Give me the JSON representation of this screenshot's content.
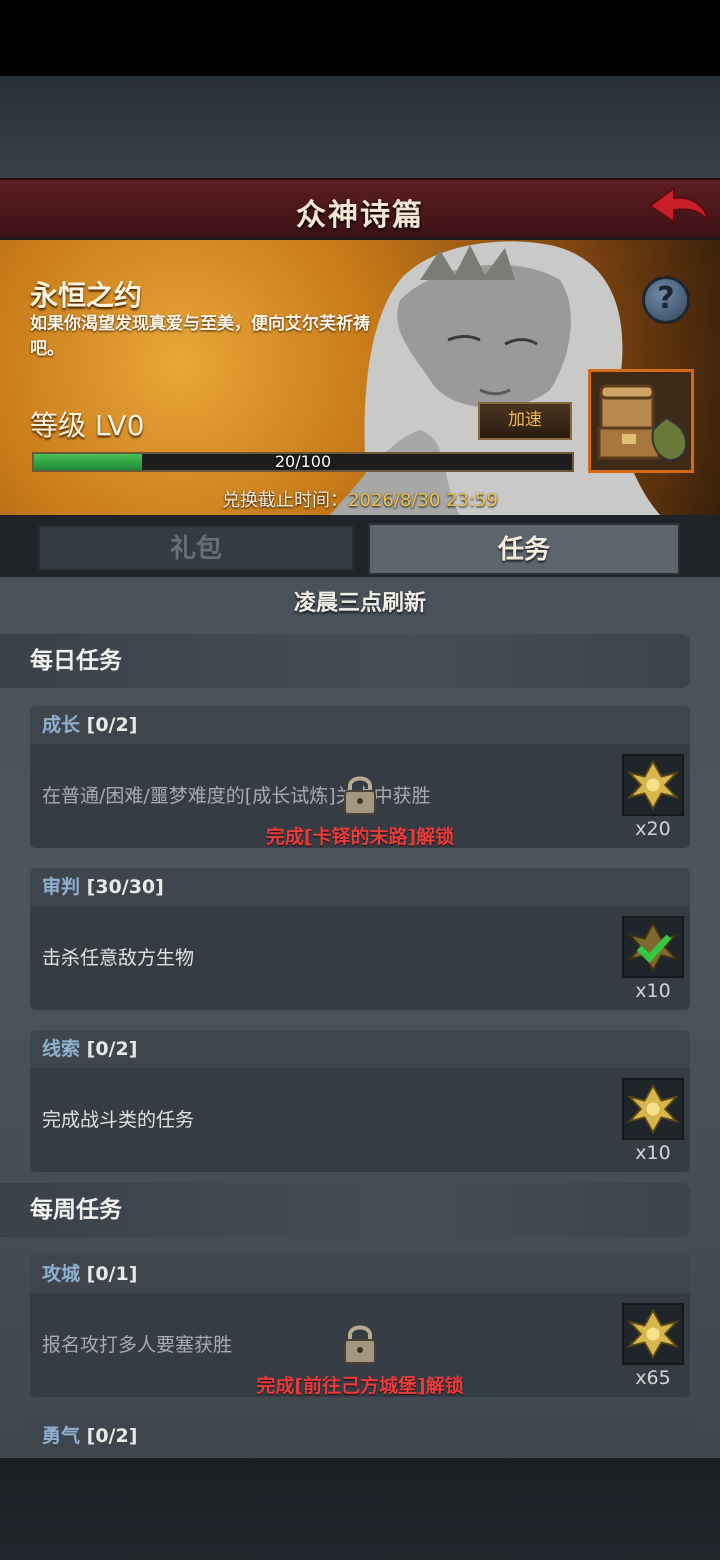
{
  "header": {
    "title": "众神诗篇"
  },
  "banner": {
    "event_title": "永恒之约",
    "description": "如果你渴望发现真爱与至美，便向艾尔芙祈祷吧。",
    "level_label": "等级 LV0",
    "speed_button": "加速",
    "progress": {
      "current": 20,
      "max": 100,
      "text": "20/100",
      "fraction": 0.2
    },
    "deadline_label": "兑换截止时间：",
    "deadline_value": "2026/8/30 23:59"
  },
  "tabs": [
    {
      "label": "礼包",
      "active": false
    },
    {
      "label": "任务",
      "active": true
    }
  ],
  "refresh_text": "凌晨三点刷新",
  "daily": {
    "title": "每日任务",
    "tasks": [
      {
        "category": "成长",
        "count": "[0/2]",
        "description": "在普通/困难/噩梦难度的[成长试炼]关卡中获胜",
        "reward_qty": "x20",
        "locked": true,
        "unlock_text": "完成[卡铎的末路]解锁",
        "completed": false
      },
      {
        "category": "审判",
        "count": "[30/30]",
        "description": "击杀任意敌方生物",
        "reward_qty": "x10",
        "locked": false,
        "completed": true
      },
      {
        "category": "线索",
        "count": "[0/2]",
        "description": "完成战斗类的任务",
        "reward_qty": "x10",
        "locked": false,
        "completed": false
      }
    ]
  },
  "weekly": {
    "title": "每周任务",
    "tasks": [
      {
        "category": "攻城",
        "count": "[0/1]",
        "description": "报名攻打多人要塞获胜",
        "reward_qty": "x65",
        "locked": true,
        "unlock_text": "完成[前往己方城堡]解锁",
        "completed": false
      },
      {
        "category": "勇气",
        "count": "[0/2]"
      }
    ]
  },
  "colors": {
    "accent_red": "#e63c3c",
    "progress_green": "#3fb451",
    "date_gold": "#f1c14a",
    "category_blue": "#8fb1d1"
  },
  "icons": {
    "back": "red-back-arrow-icon",
    "help": "question-mark-icon",
    "chest": "treasure-chest-icon",
    "reward": "golden-emblem-icon",
    "lock": "padlock-icon",
    "check": "green-check-icon"
  }
}
